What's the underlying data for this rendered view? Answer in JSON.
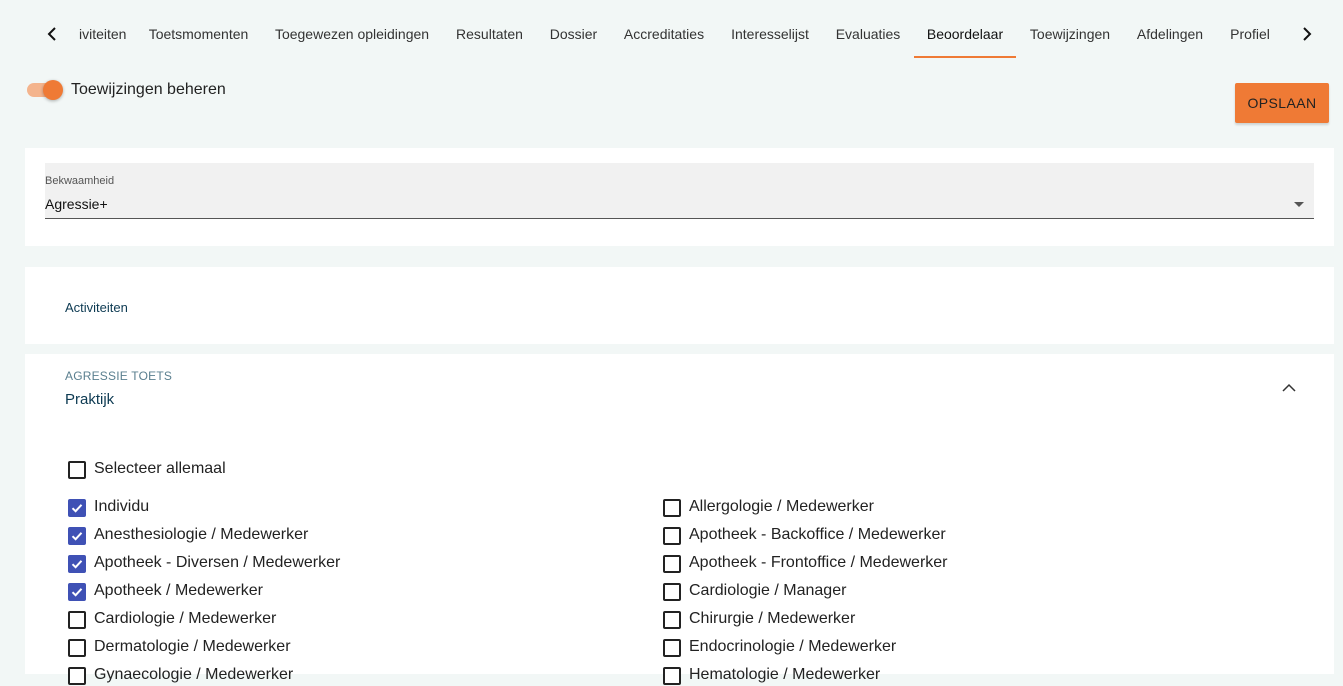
{
  "tabs": [
    {
      "label": "iviteiten",
      "active": false
    },
    {
      "label": "Toetsmomenten",
      "active": false
    },
    {
      "label": "Toegewezen opleidingen",
      "active": false
    },
    {
      "label": "Resultaten",
      "active": false
    },
    {
      "label": "Dossier",
      "active": false
    },
    {
      "label": "Accreditaties",
      "active": false
    },
    {
      "label": "Interesselijst",
      "active": false
    },
    {
      "label": "Evaluaties",
      "active": false
    },
    {
      "label": "Beoordelaar",
      "active": true
    },
    {
      "label": "Toewijzingen",
      "active": false
    },
    {
      "label": "Afdelingen",
      "active": false
    },
    {
      "label": "Profiel",
      "active": false
    }
  ],
  "toggle": {
    "label": "Toewijzingen beheren",
    "on": true
  },
  "save_button": "OPSLAAN",
  "bekwaamheid": {
    "label": "Bekwaamheid",
    "value": "Agressie+"
  },
  "activiteiten_title": "Activiteiten",
  "section": {
    "overline": "AGRESSIE TOETS",
    "title": "Praktijk"
  },
  "select_all": {
    "label": "Selecteer allemaal",
    "checked": false
  },
  "left_items": [
    {
      "label": "Individu",
      "checked": true
    },
    {
      "label": "Anesthesiologie / Medewerker",
      "checked": true
    },
    {
      "label": "Apotheek - Diversen / Medewerker",
      "checked": true
    },
    {
      "label": "Apotheek / Medewerker",
      "checked": true
    },
    {
      "label": "Cardiologie / Medewerker",
      "checked": false
    },
    {
      "label": "Dermatologie / Medewerker",
      "checked": false
    },
    {
      "label": "Gynaecologie / Medewerker",
      "checked": false
    }
  ],
  "right_items": [
    {
      "label": "Allergologie / Medewerker",
      "checked": false
    },
    {
      "label": "Apotheek - Backoffice / Medewerker",
      "checked": false
    },
    {
      "label": "Apotheek - Frontoffice / Medewerker",
      "checked": false
    },
    {
      "label": "Cardiologie / Manager",
      "checked": false
    },
    {
      "label": "Chirurgie / Medewerker",
      "checked": false
    },
    {
      "label": "Endocrinologie / Medewerker",
      "checked": false
    },
    {
      "label": "Hematologie / Medewerker",
      "checked": false
    }
  ],
  "colors": {
    "accent": "#ef7a35",
    "checkbox": "#3f51b5",
    "title": "#0d3a52"
  },
  "icons": {
    "tab_prev": "chevron-left-icon",
    "tab_next": "chevron-right-icon",
    "collapse": "chevron-up-icon",
    "select": "caret-down-icon"
  }
}
